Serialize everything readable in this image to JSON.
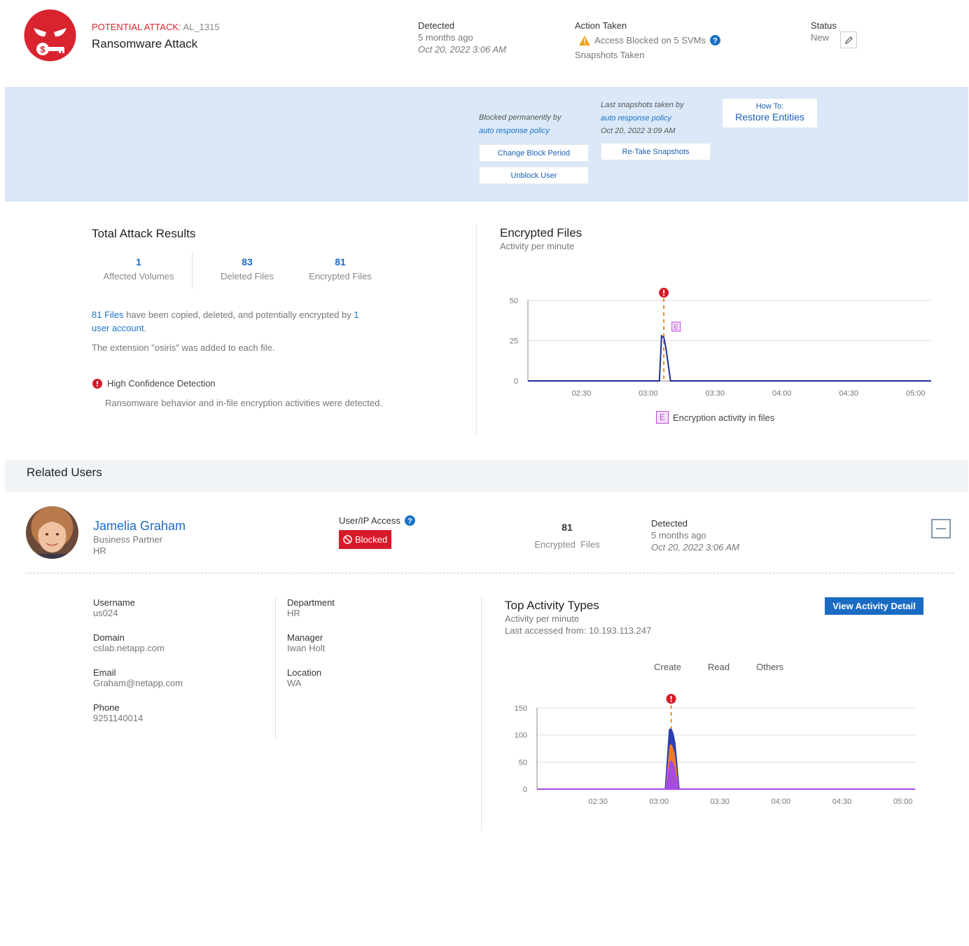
{
  "alert": {
    "prefix": "POTENTIAL ATTACK:",
    "id": "AL_1315",
    "title": "Ransomware Attack",
    "detected_label": "Detected",
    "detected_relative": "5 months ago",
    "detected_time": "Oct 20, 2022 3:06 AM",
    "action_label": "Action Taken",
    "action_text": "Access Blocked on 5 SVMs",
    "action_sub": "Snapshots Taken",
    "status_label": "Status",
    "status_value": "New"
  },
  "banner": {
    "blocked_by": "Blocked permanently by",
    "blocked_policy": "auto response policy",
    "change_block": "Change Block Period",
    "unblock": "Unblock User",
    "snap_by": "Last snapshots taken by",
    "snap_policy": "auto response policy",
    "snap_time": "Oct 20, 2022 3:09 AM",
    "retake": "Re-Take Snapshots",
    "howto_small": "How To:",
    "howto_big": "Restore Entities"
  },
  "results": {
    "title": "Total Attack Results",
    "stats": [
      {
        "value": "1",
        "label": "Affected Volumes"
      },
      {
        "value": "83",
        "label": "Deleted Files"
      },
      {
        "value": "81",
        "label": "Encrypted Files"
      }
    ],
    "summary_files": "81 Files",
    "summary_mid": " have been copied, deleted, and potentially encrypted by ",
    "summary_count": "1",
    "summary_account": "user account",
    "summary_end": ".",
    "extension_text": "The extension \"osiris\" was added to each file.",
    "confidence_title": "High Confidence Detection",
    "confidence_text": "Ransomware behavior and in-file encryption activities were detected."
  },
  "encrypted_chart": {
    "title": "Encrypted Files",
    "subtitle": "Activity per minute",
    "legend": "Encryption activity in files",
    "marker": "E",
    "colors": {
      "line": "#1c2e8f",
      "alert": "#d71a2a",
      "marker": "#c044d8",
      "dash": "#f08a1c"
    }
  },
  "related": {
    "title": "Related Users",
    "user": {
      "name": "Jamelia Graham",
      "role": "Business Partner",
      "dept": "HR",
      "access_label": "User/IP Access",
      "access_state": "Blocked",
      "encrypted_count": "81",
      "encrypted_label": "Encrypted  Files",
      "detected_label": "Detected",
      "detected_relative": "5 months ago",
      "detected_time": "Oct 20, 2022 3:06 AM"
    },
    "fields_left": [
      {
        "label": "Username",
        "value": "us024",
        "link": false
      },
      {
        "label": "Domain",
        "value": "cslab.netapp.com",
        "link": false
      },
      {
        "label": "Email",
        "value": "Graham@netapp.com",
        "link": true
      },
      {
        "label": "Phone",
        "value": "9251140014",
        "link": false
      }
    ],
    "fields_right": [
      {
        "label": "Department",
        "value": "HR",
        "link": false
      },
      {
        "label": "Manager",
        "value": "Iwan Holt",
        "link": true
      },
      {
        "label": "Location",
        "value": "WA",
        "link": false
      }
    ]
  },
  "activity": {
    "title": "Top Activity Types",
    "subtitle": "Activity per minute",
    "last_access": "Last accessed from: 10.193.113.247",
    "view_button": "View Activity Detail",
    "legend": [
      "Create",
      "Read",
      "Others"
    ]
  },
  "chart_data": [
    {
      "type": "line",
      "title": "Encrypted Files",
      "x_ticks": [
        "02:30",
        "03:00",
        "03:30",
        "04:00",
        "04:30",
        "05:00"
      ],
      "y_ticks": [
        0,
        25,
        50
      ],
      "ylim": [
        0,
        50
      ],
      "series": [
        {
          "name": "Encryption activity in files",
          "x": [
            "02:06",
            "03:02",
            "03:05",
            "03:06",
            "03:07",
            "03:08",
            "03:10",
            "05:07"
          ],
          "values": [
            0,
            0,
            0,
            28,
            27,
            20,
            0,
            0
          ]
        }
      ],
      "annotations": [
        {
          "type": "alert",
          "x": "03:07"
        },
        {
          "type": "marker",
          "label": "E",
          "x": "03:10"
        }
      ]
    },
    {
      "type": "area",
      "title": "Top Activity Types",
      "x_ticks": [
        "02:30",
        "03:00",
        "03:30",
        "04:00",
        "04:30",
        "05:00"
      ],
      "y_ticks": [
        0,
        50,
        100,
        150
      ],
      "ylim": [
        0,
        150
      ],
      "x": [
        "02:00",
        "03:03",
        "03:05",
        "03:06",
        "03:07",
        "03:08",
        "03:10",
        "05:06"
      ],
      "series": [
        {
          "name": "Create",
          "values": [
            0,
            0,
            50,
            55,
            50,
            40,
            0,
            0
          ],
          "color": "#a64ae6"
        },
        {
          "name": "Read",
          "values": [
            0,
            0,
            30,
            30,
            28,
            25,
            0,
            0
          ],
          "color": "#ef7a2a"
        },
        {
          "name": "Others",
          "values": [
            0,
            0,
            30,
            27,
            25,
            20,
            0,
            0
          ],
          "color": "#2b3fb0"
        }
      ],
      "annotations": [
        {
          "type": "alert",
          "x": "03:06"
        }
      ]
    }
  ]
}
